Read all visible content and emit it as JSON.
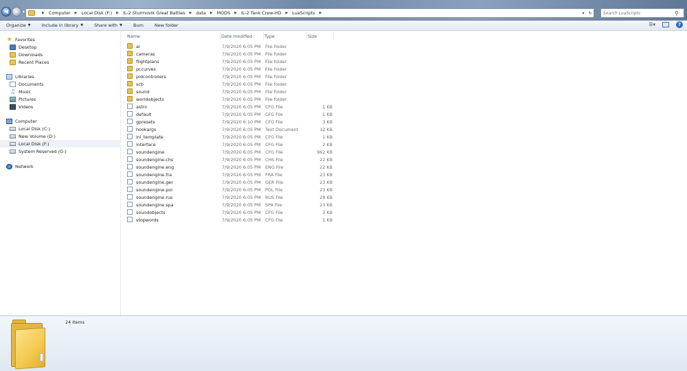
{
  "address": {
    "crumbs": [
      "Computer",
      "Local Disk (F:)",
      "IL-2 Sturmovik Great Battles",
      "data",
      "MODS",
      "IL-2 Tank Crew-HD",
      "LuaScripts"
    ]
  },
  "search": {
    "placeholder": "Search LuaScripts"
  },
  "toolbar": {
    "organize": "Organize",
    "include": "Include in library",
    "share": "Share with",
    "burn": "Burn",
    "new_folder": "New folder"
  },
  "nav": {
    "favorites": "Favorites",
    "desktop": "Desktop",
    "downloads": "Downloads",
    "recent": "Recent Places",
    "libraries": "Libraries",
    "documents": "Documents",
    "music": "Music",
    "pictures": "Pictures",
    "videos": "Videos",
    "computer": "Computer",
    "drive_c": "Local Disk (C:)",
    "drive_d": "New Volume (D:)",
    "drive_f": "Local Disk (F:)",
    "drive_g": "System Reserved (G:)",
    "network": "Network"
  },
  "columns": {
    "name": "Name",
    "date": "Date modified",
    "type": "Type",
    "size": "Size"
  },
  "files": [
    {
      "name": "ai",
      "date": "7/9/2020 6:05 PM",
      "type": "File folder",
      "size": "",
      "kind": "folder"
    },
    {
      "name": "cameras",
      "date": "7/9/2020 6:05 PM",
      "type": "File folder",
      "size": "",
      "kind": "folder"
    },
    {
      "name": "flightplans",
      "date": "7/9/2020 6:05 PM",
      "type": "File folder",
      "size": "",
      "kind": "folder"
    },
    {
      "name": "pccurves",
      "date": "7/9/2020 6:05 PM",
      "type": "File folder",
      "size": "",
      "kind": "folder"
    },
    {
      "name": "pidcontrollers",
      "date": "7/9/2020 6:05 PM",
      "type": "File folder",
      "size": "",
      "kind": "folder"
    },
    {
      "name": "scb",
      "date": "7/9/2020 6:05 PM",
      "type": "File folder",
      "size": "",
      "kind": "folder"
    },
    {
      "name": "sound",
      "date": "7/9/2020 6:05 PM",
      "type": "File folder",
      "size": "",
      "kind": "folder"
    },
    {
      "name": "worldobjects",
      "date": "7/9/2020 6:05 PM",
      "type": "File folder",
      "size": "",
      "kind": "folder"
    },
    {
      "name": "astro",
      "date": "7/9/2020 6:05 PM",
      "type": "CFG File",
      "size": "1 KB",
      "kind": "file"
    },
    {
      "name": "default",
      "date": "7/9/2020 6:05 PM",
      "type": "CFG File",
      "size": "1 KB",
      "kind": "file"
    },
    {
      "name": "gpresets",
      "date": "7/9/2020 6:10 PM",
      "type": "CFG File",
      "size": "3 KB",
      "kind": "file"
    },
    {
      "name": "hookargs",
      "date": "7/9/2020 6:05 PM",
      "type": "Text Document",
      "size": "32 KB",
      "kind": "file"
    },
    {
      "name": "ini_template",
      "date": "7/9/2020 6:05 PM",
      "type": "CFG File",
      "size": "1 KB",
      "kind": "file"
    },
    {
      "name": "interface",
      "date": "7/9/2020 6:05 PM",
      "type": "CFG File",
      "size": "2 KB",
      "kind": "file"
    },
    {
      "name": "soundengine",
      "date": "7/9/2020 6:05 PM",
      "type": "CFG File",
      "size": "962 KB",
      "kind": "file"
    },
    {
      "name": "soundengine.chs",
      "date": "7/9/2020 6:05 PM",
      "type": "CHS File",
      "size": "22 KB",
      "kind": "file"
    },
    {
      "name": "soundengine.eng",
      "date": "7/9/2020 6:05 PM",
      "type": "ENG File",
      "size": "22 KB",
      "kind": "file"
    },
    {
      "name": "soundengine.fra",
      "date": "7/9/2020 6:05 PM",
      "type": "FRA File",
      "size": "23 KB",
      "kind": "file"
    },
    {
      "name": "soundengine.ger",
      "date": "7/9/2020 6:05 PM",
      "type": "GER File",
      "size": "23 KB",
      "kind": "file"
    },
    {
      "name": "soundengine.pol",
      "date": "7/9/2020 6:05 PM",
      "type": "POL File",
      "size": "23 KB",
      "kind": "file"
    },
    {
      "name": "soundengine.rus",
      "date": "7/9/2020 6:05 PM",
      "type": "RUS File",
      "size": "28 KB",
      "kind": "file"
    },
    {
      "name": "soundengine.spa",
      "date": "7/9/2020 6:05 PM",
      "type": "SPA File",
      "size": "23 KB",
      "kind": "file"
    },
    {
      "name": "soundobjects",
      "date": "7/9/2020 6:05 PM",
      "type": "CFG File",
      "size": "3 KB",
      "kind": "file"
    },
    {
      "name": "stopwords",
      "date": "7/9/2020 6:05 PM",
      "type": "CFG File",
      "size": "1 KB",
      "kind": "file"
    }
  ],
  "details": {
    "count": "24 items"
  }
}
